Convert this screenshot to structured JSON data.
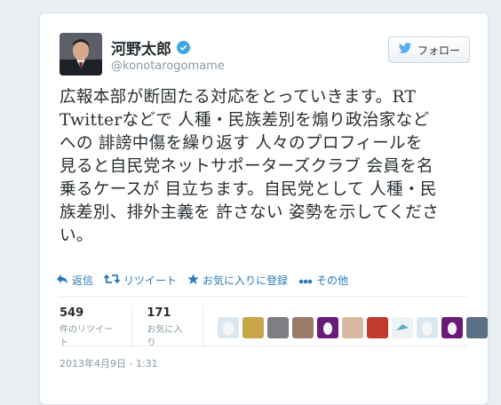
{
  "user": {
    "name": "河野太郎",
    "handle": "@konotarogomame",
    "follow_label": "フォロー"
  },
  "tweet": {
    "lines": [
      "広報本部が断固たる対応をとっていきます。RT",
      "Twitterなどで 人種・民族差別を煽り政治家など",
      "への 誹謗中傷を繰り返す 人々のプロフィールを",
      "見ると自民党ネットサポーターズクラブ 会員を名",
      "乗るケースが 目立ちます。自民党として 人種・民",
      "族差別、排外主義を 許さない 姿勢を示してくださ",
      "い。"
    ]
  },
  "actions": {
    "reply": "返信",
    "retweet": "リツイート",
    "favorite": "お気に入りに登録",
    "more": "その他"
  },
  "stats": {
    "retweets": {
      "count": "549",
      "label": "件のリツイート"
    },
    "favorites": {
      "count": "171",
      "label": "お気に入り"
    }
  },
  "timestamp": "2013年4月9日 - 1:31",
  "colors": {
    "link": "#2b7bb9",
    "verified": "#3ea6e6",
    "twitter_bird": "#55acee"
  }
}
